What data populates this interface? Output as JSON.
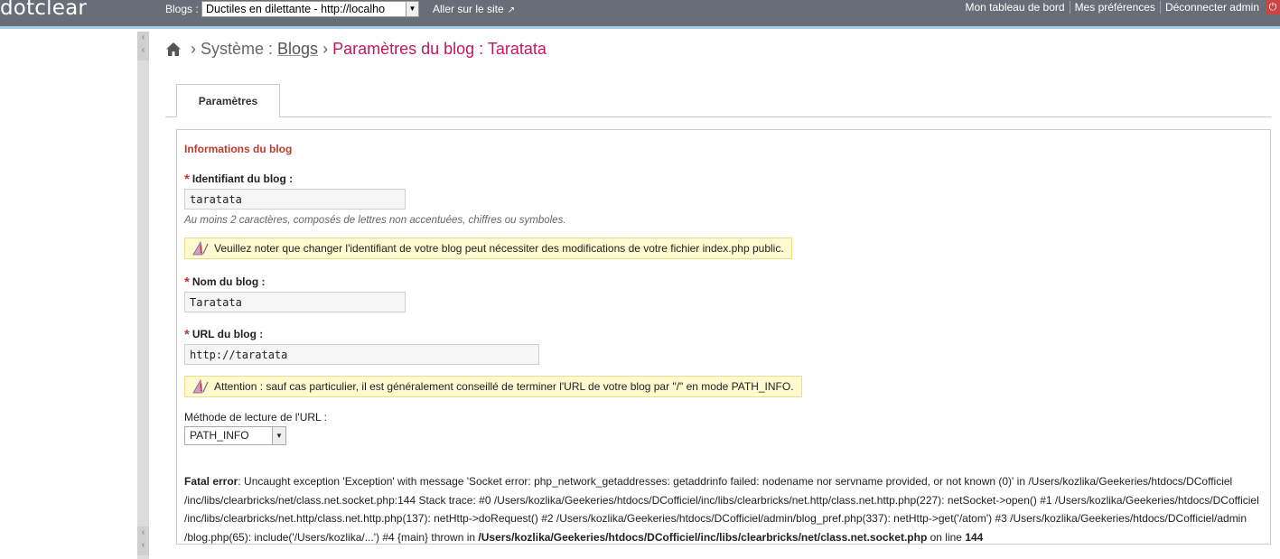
{
  "topbar": {
    "logo": "dotclear",
    "blogs_label": "Blogs :",
    "blog_select_value": "Ductiles en dilettante - http://localho",
    "site_link": "Aller sur le site",
    "dashboard": "Mon tableau de bord",
    "preferences": "Mes préférences",
    "logout": "Déconnecter admin",
    "power_icon": "⏻"
  },
  "breadcrumb": {
    "sep": "›",
    "system": "Système :",
    "blogs": "Blogs",
    "current": "Paramètres du blog : Taratata"
  },
  "tabs": [
    {
      "label": "Paramètres"
    }
  ],
  "form": {
    "legend": "Informations du blog",
    "required_mark": "*",
    "id_label": "Identifiant du blog :",
    "id_value": "taratata",
    "id_help": "Au moins 2 caractères, composés de lettres non accentuées, chiffres ou symboles.",
    "id_warning": "Veuillez noter que changer l'identifiant de votre blog peut nécessiter des modifications de votre fichier index.php public.",
    "name_label": "Nom du blog :",
    "name_value": "Taratata",
    "url_label": "URL du blog :",
    "url_value": "http://taratata",
    "url_warning": "Attention : sauf cas particulier, il est généralement conseillé de terminer l'URL de votre blog par \"/\" en mode PATH_INFO.",
    "method_label": "Méthode de lecture de l'URL :",
    "method_value": "PATH_INFO"
  },
  "error": {
    "title": "Fatal error",
    "message": ": Uncaught exception 'Exception' with message 'Socket error: php_network_getaddresses: getaddrinfo failed: nodename nor servname provided, or not known (0)' in /Users/kozlika/Geekeries/htdocs/DCofficiel /inc/libs/clearbricks/net/class.net.socket.php:144 Stack trace: #0 /Users/kozlika/Geekeries/htdocs/DCofficiel/inc/libs/clearbricks/net.http/class.net.http.php(227): netSocket->open() #1 /Users/kozlika/Geekeries/htdocs/DCofficiel /inc/libs/clearbricks/net.http/class.net.http.php(137): netHttp->doRequest() #2 /Users/kozlika/Geekeries/htdocs/DCofficiel/admin/blog_pref.php(337): netHttp->get('/atom') #3 /Users/kozlika/Geekeries/htdocs/DCofficiel/admin /blog.php(65): include('/Users/kozlika/...') #4 {main} thrown in ",
    "file": "/Users/kozlika/Geekeries/htdocs/DCofficiel/inc/libs/clearbricks/net/class.net.socket.php",
    "on_line": " on line ",
    "line": "144"
  }
}
